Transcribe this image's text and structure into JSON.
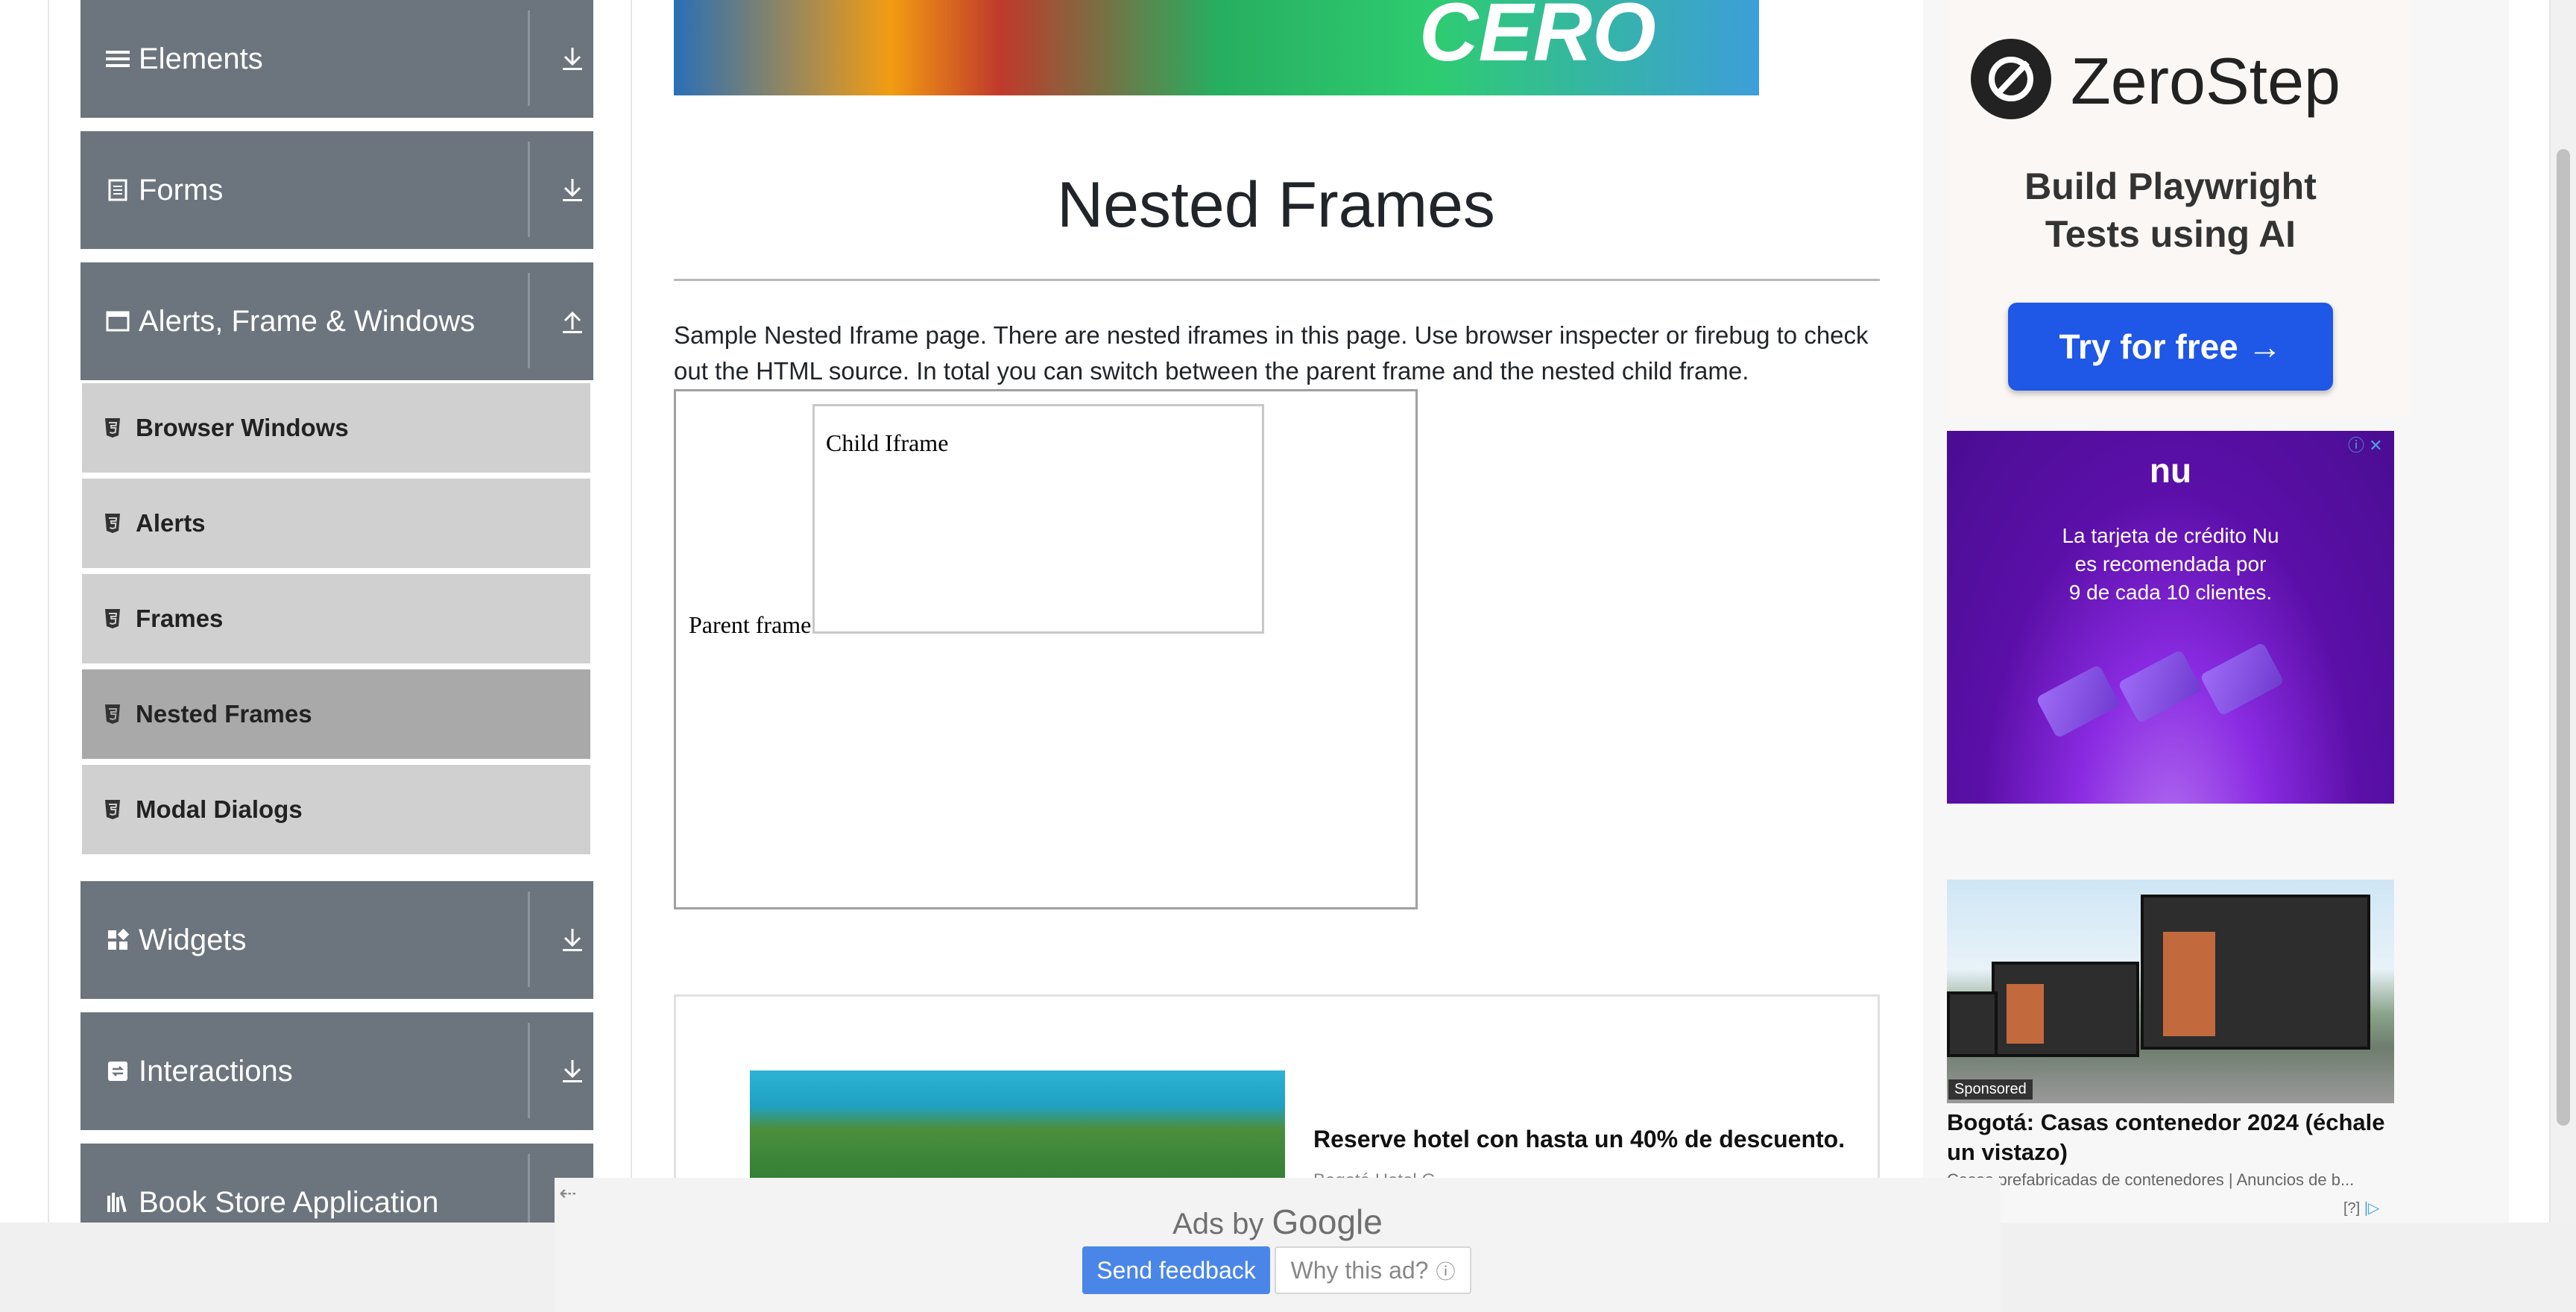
{
  "sidebar": {
    "groups": {
      "elements": {
        "label": "Elements"
      },
      "forms": {
        "label": "Forms"
      },
      "alerts": {
        "label": "Alerts, Frame & Windows"
      },
      "widgets": {
        "label": "Widgets"
      },
      "interactions": {
        "label": "Interactions"
      },
      "bookstore": {
        "label": "Book Store Application"
      }
    },
    "items": [
      {
        "label": "Browser Windows"
      },
      {
        "label": "Alerts"
      },
      {
        "label": "Frames"
      },
      {
        "label": "Nested Frames"
      },
      {
        "label": "Modal Dialogs"
      }
    ]
  },
  "main": {
    "title": "Nested Frames",
    "description": "Sample Nested Iframe page. There are nested iframes in this page. Use browser inspecter or firebug to check out the HTML source. In total you can switch between the parent frame and the nested child frame.",
    "parent_frame_text": "Parent frame",
    "child_frame_text": "Child Iframe",
    "banner_text": "CERO",
    "hotel_ad": {
      "title": "Reserve hotel con hasta un 40% de descuento.",
      "sub": "Bogotá Hotel G..."
    }
  },
  "google_bar": {
    "ads_by": "Ads by",
    "google": "Google",
    "send_feedback": "Send feedback",
    "why_ad": "Why this ad?",
    "back": "⇠"
  },
  "right_ads": {
    "zerostep": {
      "name": "ZeroStep",
      "tagline_1": "Build Playwright",
      "tagline_2": "Tests using AI",
      "cta": "Try for free →"
    },
    "nu": {
      "logo": "nu",
      "line1": "La tarjeta de crédito Nu",
      "line2": "es recomendada por",
      "line3": "9 de cada 10 clientes."
    },
    "house": {
      "sponsored": "Sponsored",
      "title": "Bogotá: Casas contenedor 2024 (échale un vistazo)",
      "sub": "Casas prefabricadas de contenedores | Anuncios de b...",
      "help": "[?]"
    }
  },
  "colors": {
    "sidebar_header": "#6c757d",
    "menu_item": "#d0d0d0",
    "menu_active": "#a9a9a9",
    "zerostep_btn": "#1f57e6",
    "feedback_btn": "#4a86e8"
  }
}
